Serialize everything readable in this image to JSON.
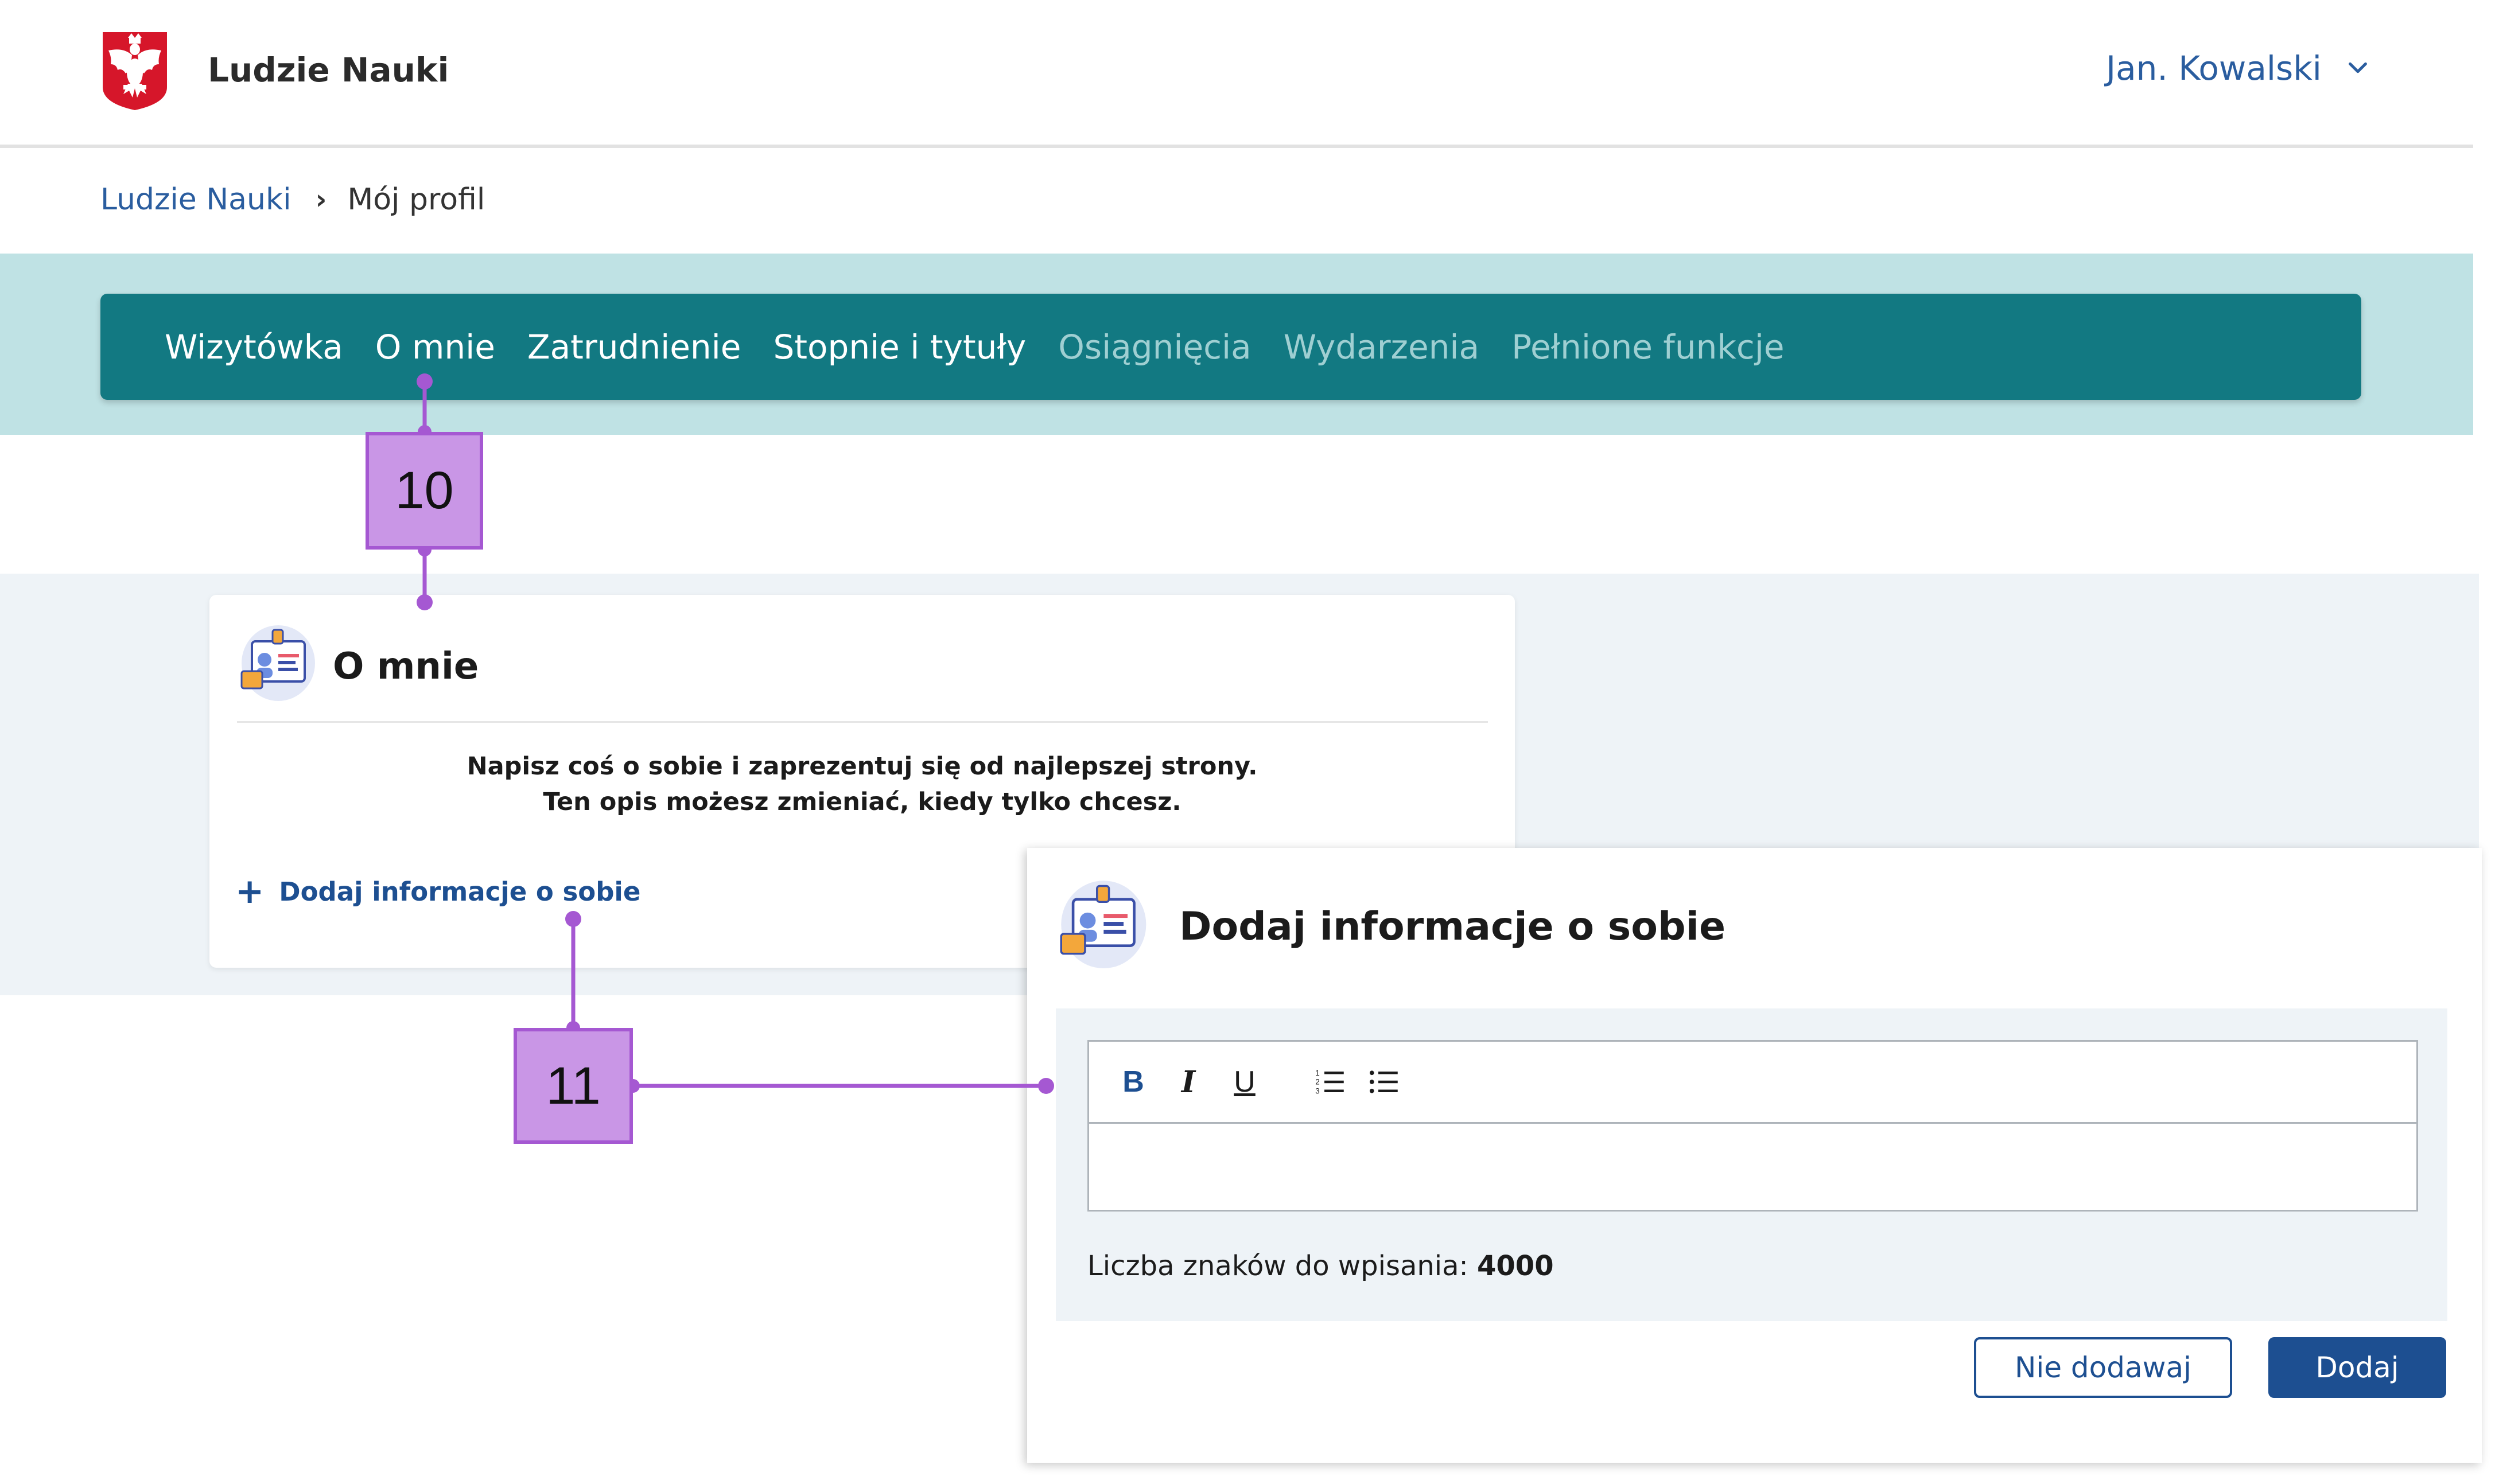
{
  "header": {
    "app_title": "Ludzie Nauki",
    "user_name": "Jan. Kowalski"
  },
  "breadcrumb": {
    "items": [
      "Ludzie Nauki",
      "Mój profil"
    ],
    "separator": "›"
  },
  "tabs": [
    {
      "label": "Wizytówka",
      "enabled": true
    },
    {
      "label": "O mnie",
      "enabled": true
    },
    {
      "label": "Zatrudnienie",
      "enabled": true
    },
    {
      "label": "Stopnie i tytuły",
      "enabled": true
    },
    {
      "label": "Osiągnięcia",
      "enabled": false
    },
    {
      "label": "Wydarzenia",
      "enabled": false
    },
    {
      "label": "Pełnione funkcje",
      "enabled": false
    }
  ],
  "about_card": {
    "title": "O mnie",
    "description_line1": "Napisz coś o sobie i zaprezentuj się od najlepszej strony.",
    "description_line2": "Ten opis możesz zmieniać, kiedy tylko chcesz.",
    "add_link_icon": "+",
    "add_link": "Dodaj informacje o sobie"
  },
  "modal": {
    "title": "Dodaj informacje o sobie",
    "toolbar": {
      "bold": "B",
      "italic": "I",
      "underline": "U",
      "ordered_list_icon": "ordered-list-icon",
      "bullet_list_icon": "bullet-list-icon"
    },
    "editor_value": "",
    "char_count_label": "Liczba znaków do wpisania:",
    "char_count_value": "4000",
    "cancel_button": "Nie dodawaj",
    "submit_button": "Dodaj"
  },
  "callouts": [
    "10",
    "11"
  ],
  "colors": {
    "tab_bar": "#127982",
    "tab_band": "#bfe2e4",
    "primary": "#1d4f91",
    "link": "#2a5d9f",
    "callout_fill": "#c996e6",
    "callout_border": "#a558d2",
    "panel_bg": "#eef3f7"
  }
}
